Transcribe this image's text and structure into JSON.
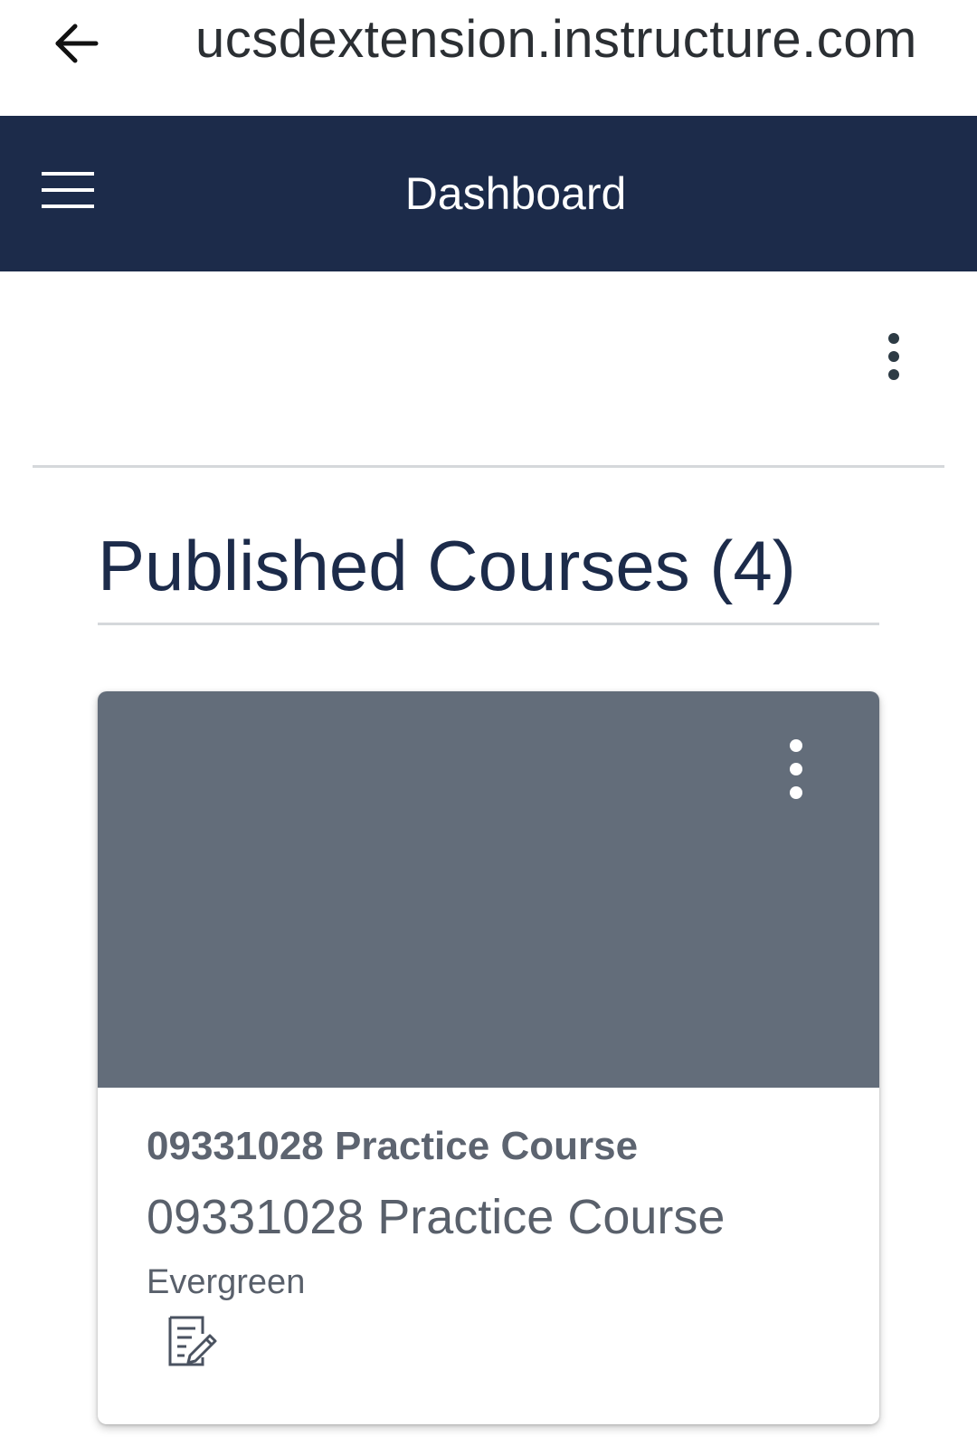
{
  "browser": {
    "url": "ucsdextension.instructure.com",
    "back_icon": "arrow-left-icon"
  },
  "header": {
    "menu_icon": "hamburger-menu-icon",
    "title": "Dashboard",
    "background_color": "#1c2b4a"
  },
  "page_options_icon": "kebab-vertical-icon",
  "section": {
    "title": "Published Courses (4)"
  },
  "courses": [
    {
      "short_name": "09331028 Practice Course",
      "name": "09331028 Practice Course",
      "term": "Evergreen",
      "hero_color": "#636d7a",
      "options_icon": "kebab-vertical-icon",
      "action_icon": "assignments-icon"
    }
  ]
}
